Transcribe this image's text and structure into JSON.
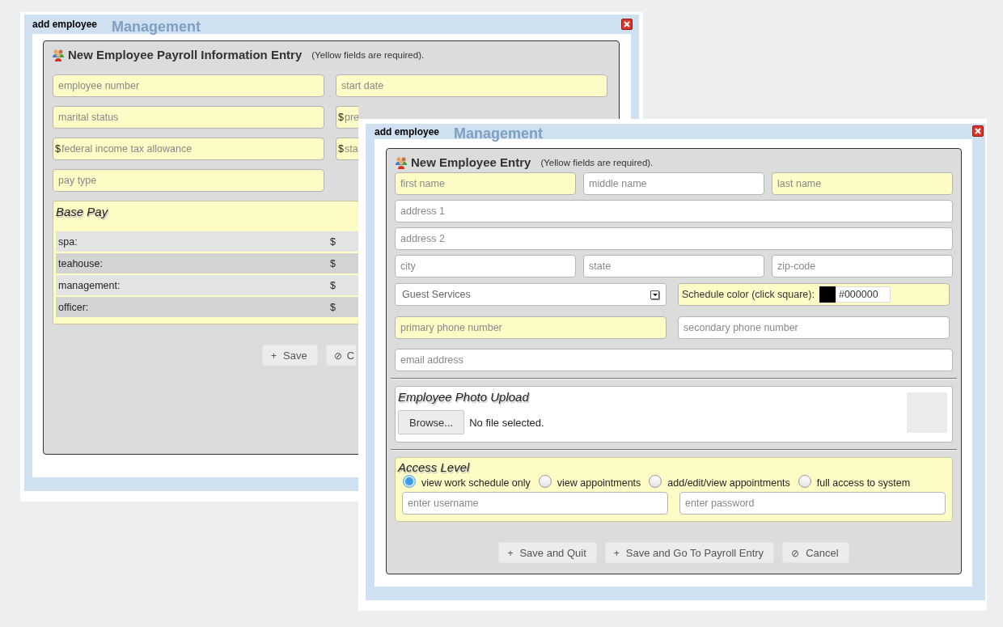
{
  "windows": [
    {
      "kind": "payroll",
      "title": "add employee",
      "background_heading": "Management",
      "heading": "New Employee Payroll Information Entry",
      "note": "(Yellow fields are required).",
      "fields": [
        {
          "placeholder": "employee number",
          "required": true
        },
        {
          "placeholder": "start date",
          "required": true
        },
        {
          "placeholder": "marital status",
          "required": true
        },
        {
          "prefix": "$",
          "placeholder": "pre",
          "required": true
        },
        {
          "prefix": "$",
          "placeholder": "federal income tax allowance",
          "required": true
        },
        {
          "prefix": "$",
          "placeholder": "sta",
          "required": true
        },
        {
          "placeholder": "pay type",
          "required": true
        }
      ],
      "base_pay": {
        "title": "Base Pay",
        "rows": [
          {
            "label": "spa:",
            "currency": "$"
          },
          {
            "label": "teahouse:",
            "currency": "$"
          },
          {
            "label": "management:",
            "currency": "$"
          },
          {
            "label": "officer:",
            "currency": "$"
          }
        ]
      },
      "buttons": [
        {
          "icon": "+",
          "label": "Save"
        },
        {
          "icon": "⊘",
          "label": "C"
        }
      ]
    },
    {
      "kind": "employee",
      "title": "add employee",
      "background_heading": "Management",
      "heading": "New Employee Entry",
      "note": "(Yellow fields are required).",
      "rows": [
        {
          "fields": [
            {
              "kind": "input",
              "placeholder": "first name",
              "required": true
            },
            {
              "kind": "input",
              "placeholder": "middle name",
              "required": false
            },
            {
              "kind": "input",
              "placeholder": "last name",
              "required": true
            }
          ]
        },
        {
          "fields": [
            {
              "kind": "input",
              "placeholder": "address 1",
              "required": false
            }
          ]
        },
        {
          "fields": [
            {
              "kind": "input",
              "placeholder": "address 2",
              "required": false
            }
          ]
        },
        {
          "fields": [
            {
              "kind": "input",
              "placeholder": "city",
              "required": false
            },
            {
              "kind": "input",
              "placeholder": "state",
              "required": false
            },
            {
              "kind": "input",
              "placeholder": "zip-code",
              "required": false
            }
          ]
        },
        {
          "fields": [
            {
              "kind": "select",
              "value": "Guest Services",
              "required": false
            },
            {
              "kind": "color",
              "label": "Schedule color (click square):",
              "color": "#000000",
              "value": "#000000",
              "required": true
            }
          ]
        },
        {
          "fields": [
            {
              "kind": "input",
              "placeholder": "primary phone number",
              "required": true
            },
            {
              "kind": "input",
              "placeholder": "secondary phone number",
              "required": false
            }
          ]
        },
        {
          "fields": [
            {
              "kind": "input",
              "placeholder": "email address",
              "required": false
            }
          ]
        }
      ],
      "photo": {
        "title": "Employee Photo Upload",
        "button": "Browse...",
        "status": "No file selected."
      },
      "access": {
        "title": "Access Level",
        "options": [
          {
            "label": "view work schedule only",
            "selected": true
          },
          {
            "label": "view appointments",
            "selected": false
          },
          {
            "label": "add/edit/view appointments",
            "selected": false
          },
          {
            "label": "full access to system",
            "selected": false
          }
        ],
        "fields": [
          {
            "placeholder": "enter username"
          },
          {
            "placeholder": "enter password"
          }
        ]
      },
      "buttons": [
        {
          "icon": "+",
          "label": "Save and Quit"
        },
        {
          "icon": "+",
          "label": "Save and Go To Payroll Entry"
        },
        {
          "icon": "⊘",
          "label": "Cancel"
        }
      ]
    }
  ]
}
